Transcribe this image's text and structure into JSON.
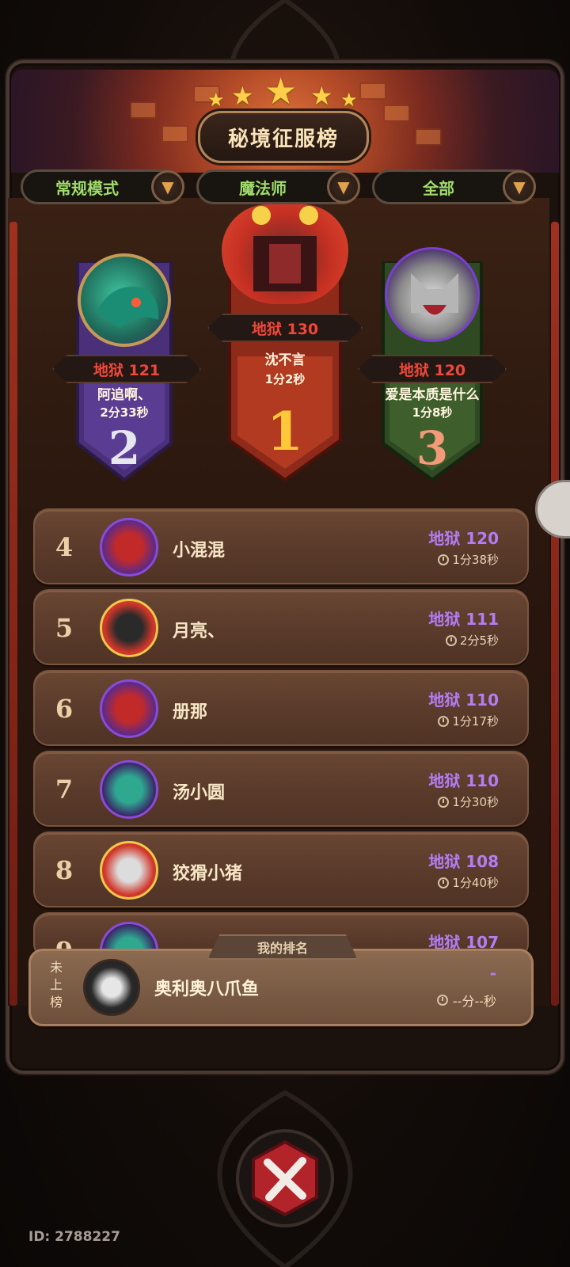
{
  "header": {
    "title": "秘境征服榜"
  },
  "filters": [
    {
      "label": "常规模式"
    },
    {
      "label": "魔法师"
    },
    {
      "label": "全部"
    }
  ],
  "podium": {
    "first": {
      "rank": "1",
      "score": "地狱 130",
      "name": "沈不言",
      "time": "1分2秒"
    },
    "second": {
      "rank": "2",
      "score": "地狱 121",
      "name": "阿追啊、",
      "time": "2分33秒"
    },
    "third": {
      "rank": "3",
      "score": "地狱 120",
      "name": "爱是本质是什么",
      "time": "1分8秒"
    }
  },
  "rows": [
    {
      "rank": "4",
      "name": "小混混",
      "score": "地狱 120",
      "time": "1分38秒"
    },
    {
      "rank": "5",
      "name": "月亮、",
      "score": "地狱 111",
      "time": "2分5秒"
    },
    {
      "rank": "6",
      "name": "册那",
      "score": "地狱 110",
      "time": "1分17秒"
    },
    {
      "rank": "7",
      "name": "汤小圆",
      "score": "地狱 110",
      "time": "1分30秒"
    },
    {
      "rank": "8",
      "name": "狡猾小猪",
      "score": "地狱 108",
      "time": "1分40秒"
    },
    {
      "rank": "9",
      "name": "",
      "score": "地狱 107",
      "time": ""
    }
  ],
  "my_rank": {
    "tab_label": "我的排名",
    "status": "未上榜",
    "name": "奥利奥八爪鱼",
    "score": "-",
    "time": "--分--秒"
  },
  "footer": {
    "uid": "ID: 2788227"
  },
  "colors": {
    "score_purple": "#b37df5",
    "hell_red": "#f0473a",
    "filter_green": "#9fdc6b",
    "gold": "#ffcf4a"
  }
}
